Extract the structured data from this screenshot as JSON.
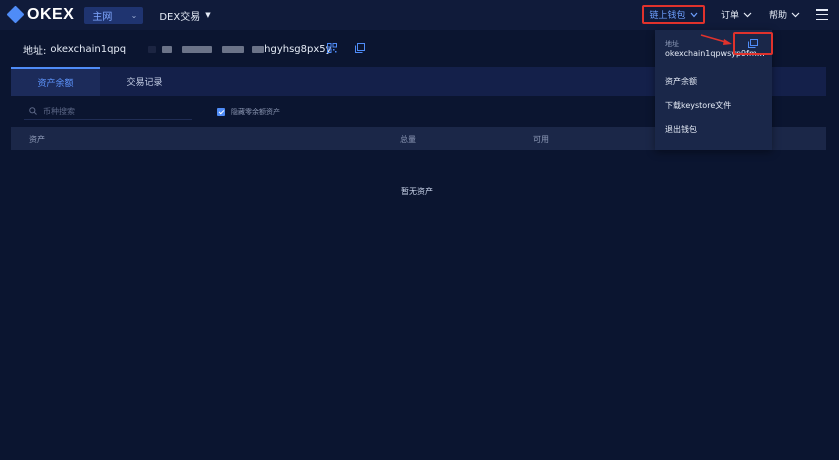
{
  "topnav": {
    "logo_text": "OKEX",
    "network": "主网",
    "dex_menu": "DEX交易",
    "wallet_button": "链上钱包",
    "order_menu": "订单",
    "help_menu": "帮助"
  },
  "address_row": {
    "label": "地址:",
    "address_start": "okexchain1qpq",
    "address_end": "hgyhsg8px5y"
  },
  "tabs": [
    {
      "label": "资产余额",
      "active": true
    },
    {
      "label": "交易记录",
      "active": false
    }
  ],
  "filters": {
    "search_placeholder": "币种搜索",
    "hide_zero_label": "隐藏零余额资产",
    "hide_zero_checked": true
  },
  "table": {
    "columns": [
      "资产",
      "总量",
      "可用"
    ],
    "empty_text": "暂无资产"
  },
  "wallet_dropdown": {
    "address_label": "地址",
    "address": "okexchain1qpwsyp9fma...",
    "items": [
      "资产余额",
      "下载keystore文件",
      "退出钱包"
    ]
  },
  "colors": {
    "background": "#0b1530",
    "accent": "#4f8cf7",
    "highlight_box": "#e0322c"
  }
}
